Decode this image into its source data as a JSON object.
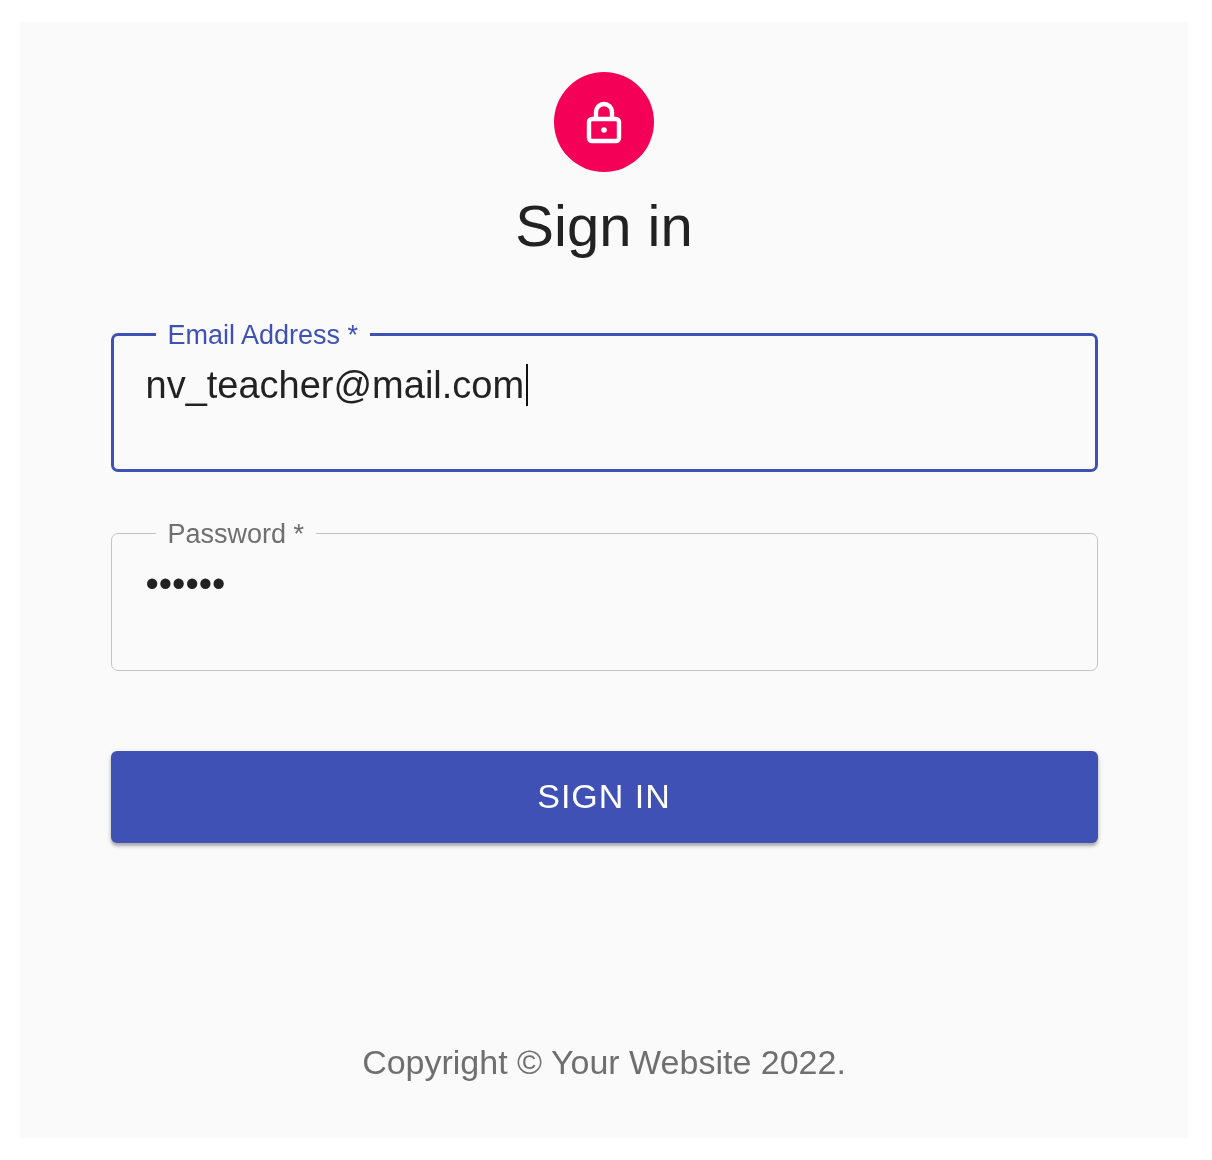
{
  "title": "Sign in",
  "fields": [
    {
      "label": "Email Address *",
      "value": "nv_teacher@mail.com",
      "focused": true
    },
    {
      "label": "Password *",
      "value": "••••••",
      "focused": false
    }
  ],
  "submit_button": "SIGN IN",
  "footer": "Copyright © Your Website 2022."
}
